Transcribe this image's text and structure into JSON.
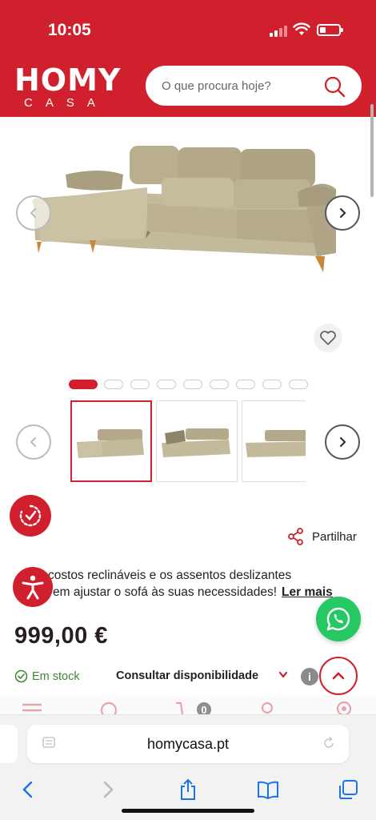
{
  "status_bar": {
    "time": "10:05"
  },
  "header": {
    "logo_top": "HOMY",
    "logo_bottom": "CASA",
    "search_placeholder": "O que procura hoje?",
    "brand_color": "#d0202e"
  },
  "gallery": {
    "image_count": 9,
    "active_index": 0,
    "thumbnails": [
      "chaise-longue-view-1",
      "chaise-longue-storage-open",
      "chaise-longue-side-view"
    ],
    "icons": {
      "prev": "chevron-left-icon",
      "next": "chevron-right-icon",
      "favorite": "heart-icon"
    }
  },
  "actions": {
    "share_label": "Partilhar"
  },
  "description": {
    "line1": "costos reclináveis e os assentos deslizantes",
    "line2": "em ajustar o sofá às suas necessidades!",
    "more_label": "Ler mais"
  },
  "product": {
    "price": "999,00 €",
    "stock_label": "Em stock",
    "availability_label": "Consultar disponibilidade",
    "info_label": "i",
    "stock_color": "#3a8a2e"
  },
  "floating": {
    "whatsapp_color": "#25c862"
  },
  "browser": {
    "url": "homycasa.pt"
  }
}
